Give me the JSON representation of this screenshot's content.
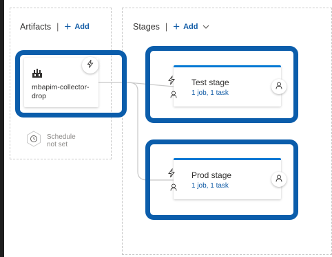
{
  "artifacts": {
    "title": "Artifacts",
    "add_label": "Add",
    "items": [
      {
        "name": "mbapim-collector-drop"
      }
    ],
    "schedule": {
      "line1": "Schedule",
      "line2": "not set"
    }
  },
  "stages": {
    "title": "Stages",
    "add_label": "Add",
    "items": [
      {
        "name": "Test stage",
        "summary": "1 job, 1 task"
      },
      {
        "name": "Prod stage",
        "summary": "1 job, 1 task"
      }
    ]
  },
  "colors": {
    "highlight": "#0b5dab",
    "accent": "#0078d4",
    "link": "#0f5aa5"
  },
  "icons": {
    "artifact": "build-artifact-icon",
    "trigger": "lightning-bolt-icon",
    "person": "person-icon",
    "schedule": "clock-icon",
    "add": "plus-icon",
    "dropdown": "chevron-down-icon"
  }
}
